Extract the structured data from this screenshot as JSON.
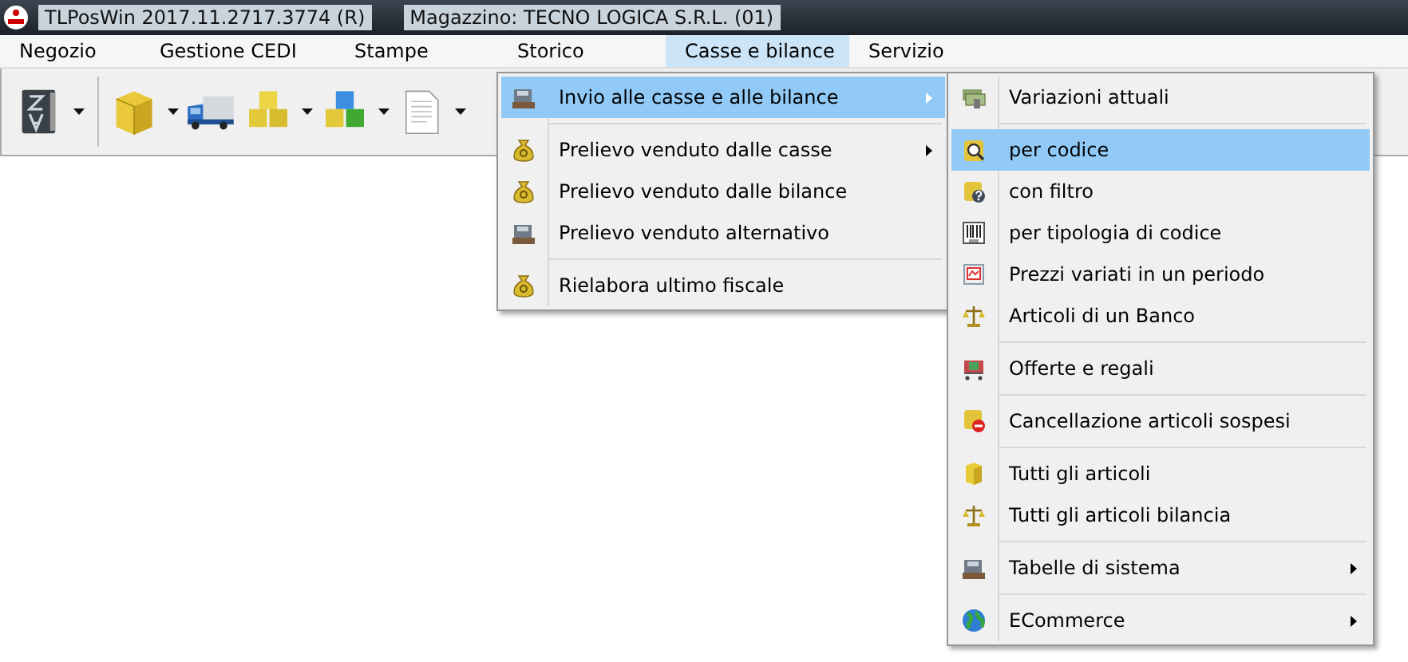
{
  "window": {
    "title": "TLPosWin 2017.11.2717.3774 (R)",
    "subtitle": "Magazzino: TECNO LOGICA S.R.L. (01)"
  },
  "menubar": [
    {
      "label": "Negozio",
      "selected": false
    },
    {
      "label": "Gestione CEDI",
      "selected": false
    },
    {
      "label": "Stampe",
      "selected": false
    },
    {
      "label": "Storico",
      "selected": false
    },
    {
      "label": "Casse e bilance",
      "selected": true
    },
    {
      "label": "Servizio",
      "selected": false
    }
  ],
  "menu": [
    {
      "kind": "item",
      "label": "Invio alle casse e alle bilance",
      "selected": true,
      "submenu": true
    },
    {
      "kind": "separator"
    },
    {
      "kind": "item",
      "label": "Prelievo venduto dalle casse",
      "selected": false,
      "submenu": true
    },
    {
      "kind": "item",
      "label": "Prelievo venduto dalle bilance",
      "selected": false,
      "submenu": false
    },
    {
      "kind": "item",
      "label": "Prelievo venduto alternativo",
      "selected": false,
      "submenu": false
    },
    {
      "kind": "separator"
    },
    {
      "kind": "item",
      "label": "Rielabora ultimo fiscale",
      "selected": false,
      "submenu": false
    }
  ],
  "submenu": [
    {
      "kind": "item",
      "label": "Variazioni attuali",
      "selected": false,
      "submenu": false
    },
    {
      "kind": "separator"
    },
    {
      "kind": "item",
      "label": "per codice",
      "selected": true,
      "submenu": false
    },
    {
      "kind": "item",
      "label": "con filtro",
      "selected": false,
      "submenu": false
    },
    {
      "kind": "item",
      "label": "per tipologia di codice",
      "selected": false,
      "submenu": false
    },
    {
      "kind": "item",
      "label": "Prezzi variati in un periodo",
      "selected": false,
      "submenu": false
    },
    {
      "kind": "item",
      "label": "Articoli di un Banco",
      "selected": false,
      "submenu": false
    },
    {
      "kind": "separator"
    },
    {
      "kind": "item",
      "label": "Offerte e regali",
      "selected": false,
      "submenu": false
    },
    {
      "kind": "separator"
    },
    {
      "kind": "item",
      "label": "Cancellazione articoli sospesi",
      "selected": false,
      "submenu": false
    },
    {
      "kind": "separator"
    },
    {
      "kind": "item",
      "label": "Tutti gli articoli",
      "selected": false,
      "submenu": false
    },
    {
      "kind": "item",
      "label": "Tutti gli articoli bilancia",
      "selected": false,
      "submenu": false
    },
    {
      "kind": "separator"
    },
    {
      "kind": "item",
      "label": "Tabelle di sistema",
      "selected": false,
      "submenu": true
    },
    {
      "kind": "separator"
    },
    {
      "kind": "item",
      "label": "ECommerce",
      "selected": false,
      "submenu": true
    }
  ]
}
